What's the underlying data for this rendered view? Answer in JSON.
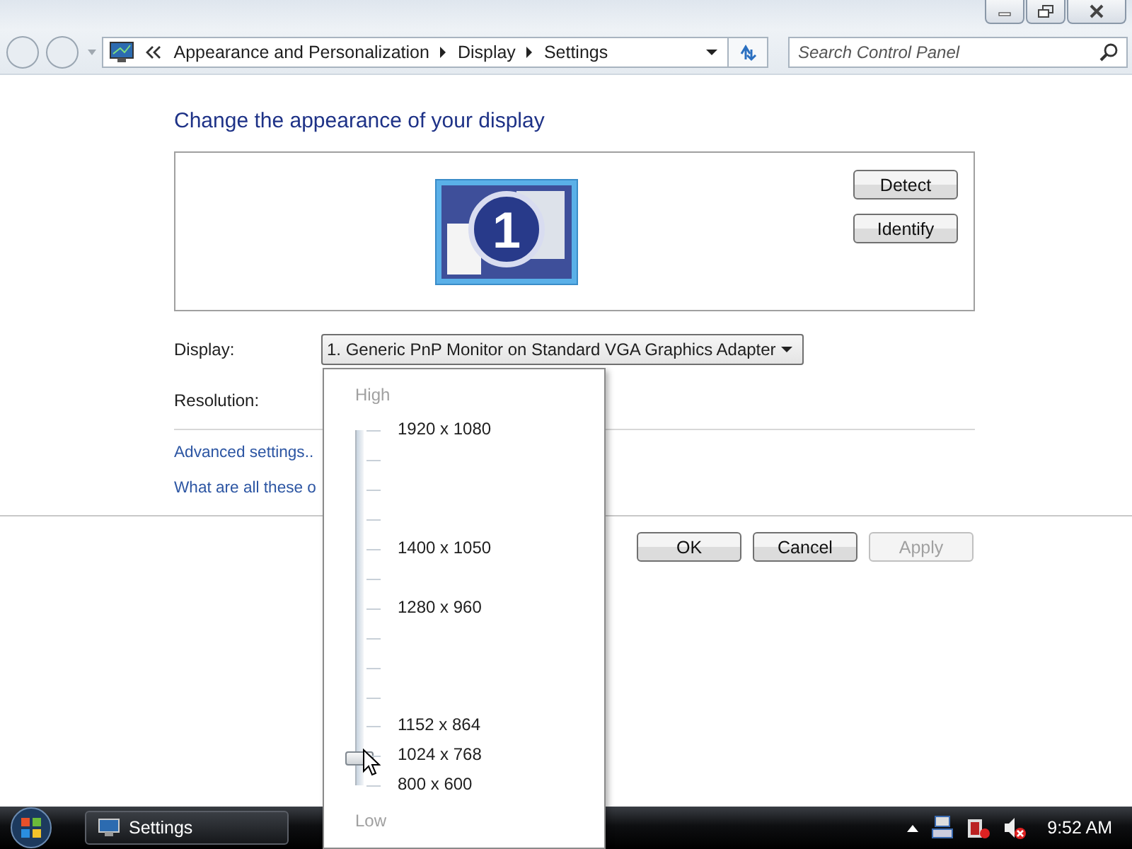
{
  "navigation": {
    "breadcrumb": [
      {
        "label": "Appearance and Personalization"
      },
      {
        "label": "Display"
      },
      {
        "label": "Settings"
      }
    ],
    "search": {
      "placeholder": "Search Control Panel"
    }
  },
  "heading": "Change the appearance of your display",
  "monitor_preview": {
    "number": "1",
    "buttons": [
      {
        "label": "Detect"
      },
      {
        "label": "Identify"
      }
    ]
  },
  "display": {
    "label": "Display:",
    "value": "1. Generic PnP Monitor on Standard VGA Graphics Adapter"
  },
  "resolution": {
    "label": "Resolution:",
    "popup": {
      "high": "High",
      "low": "Low",
      "level": 0.08,
      "marks": [
        "1920 x 1080",
        "1400 x 1050",
        "1280 x 960",
        "1152 x 864",
        "1024 x 768",
        "800 x 600"
      ]
    }
  },
  "links": [
    "Advanced settings..",
    "What are all these o"
  ],
  "buttons": [
    {
      "label": "OK",
      "disabled": false
    },
    {
      "label": "Cancel",
      "disabled": false
    },
    {
      "label": "Apply",
      "disabled": true
    }
  ],
  "taskbar": {
    "items": [
      {
        "label": "Settings"
      }
    ],
    "clock": "9:52 AM"
  }
}
